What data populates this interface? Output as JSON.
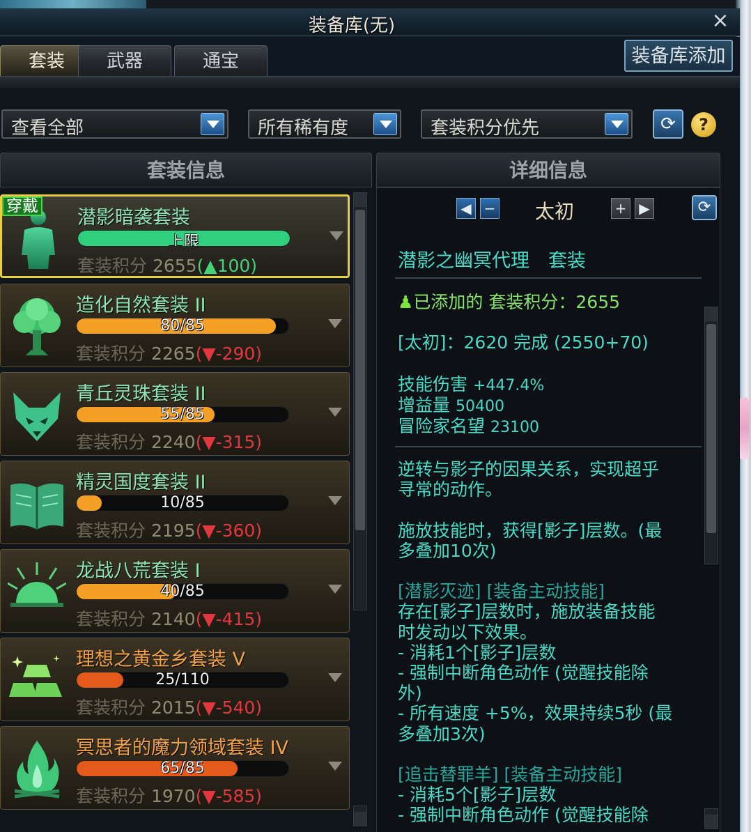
{
  "window": {
    "title": "装备库(无)",
    "close": "×"
  },
  "tabs": [
    {
      "label": "套装",
      "active": true
    },
    {
      "label": "武器",
      "active": false
    },
    {
      "label": "通宝",
      "active": false
    }
  ],
  "add_button": "装备库添加",
  "filters": {
    "view": "查看全部",
    "rarity": "所有稀有度",
    "sort": "套装积分优先"
  },
  "headers": {
    "left": "套装信息",
    "right": "详细信息"
  },
  "score_label": "套装积分",
  "sets": [
    {
      "name": "潜影暗袭套装",
      "progress_text": "上限",
      "progress": 1.0,
      "fill_color": "#2fd07d",
      "score": "2655",
      "delta": "100",
      "delta_dir": "up",
      "badge": "穿戴",
      "icon": "body-silhouette-icon",
      "name_color": "green",
      "selected": true
    },
    {
      "name": "造化自然套装 II",
      "progress_text": "80/85",
      "progress": 0.94,
      "fill_color": "#f3a024",
      "score": "2265",
      "delta": "-290",
      "delta_dir": "down",
      "icon": "tree-icon",
      "name_color": "green"
    },
    {
      "name": "青丘灵珠套装 II",
      "progress_text": "55/85",
      "progress": 0.65,
      "fill_color": "#f3a024",
      "score": "2240",
      "delta": "-315",
      "delta_dir": "down",
      "icon": "fox-icon",
      "name_color": "green"
    },
    {
      "name": "精灵国度套装 II",
      "progress_text": "10/85",
      "progress": 0.12,
      "fill_color": "#f3a024",
      "score": "2195",
      "delta": "-360",
      "delta_dir": "down",
      "icon": "book-icon",
      "name_color": "green"
    },
    {
      "name": "龙战八荒套装 I",
      "progress_text": "40/85",
      "progress": 0.47,
      "fill_color": "#f3a024",
      "score": "2140",
      "delta": "-415",
      "delta_dir": "down",
      "icon": "sunrise-icon",
      "name_color": "green"
    },
    {
      "name": "理想之黄金乡套装 V",
      "progress_text": "25/110",
      "progress": 0.22,
      "fill_color": "#e35a1a",
      "score": "2015",
      "delta": "-540",
      "delta_dir": "down",
      "icon": "gold-bars-icon",
      "name_color": "orange"
    },
    {
      "name": "冥思者的魔力领域套装 IV",
      "progress_text": "65/85",
      "progress": 0.76,
      "fill_color": "#e35a1a",
      "score": "1970",
      "delta": "-585",
      "delta_dir": "down",
      "icon": "flame-icon",
      "name_color": "orange"
    }
  ],
  "detail": {
    "level": "太初",
    "heading": "潜影之幽冥代理　套装",
    "added_label": "已添加的",
    "added_score": "套装积分：2655",
    "level_line": "[太初]：2620 完成 (2550+70)",
    "stats": [
      {
        "label": "技能伤害",
        "value": "+447.4%"
      },
      {
        "label": "增益量",
        "value": "50400"
      },
      {
        "label": "冒险家名望",
        "value": "23100"
      }
    ],
    "desc": [
      "逆转与影子的因果关系，实现超乎",
      "寻常的动作。",
      "",
      "施放技能时，获得[影子]层数。(最",
      "多叠加10次)",
      "",
      "[潜影灭迹] [装备主动技能]",
      "存在[影子]层数时，施放装备技能",
      "时发动以下效果。",
      "- 消耗1个[影子]层数",
      "- 强制中断角色动作 (觉醒技能除",
      "外)",
      "- 所有速度 +5%，效果持续5秒 (最",
      "多叠加3次)",
      "",
      "[追击替罪羊] [装备主动技能]",
      "- 消耗5个[影子]层数",
      "- 强制中断角色动作 (觉醒技能除"
    ]
  }
}
